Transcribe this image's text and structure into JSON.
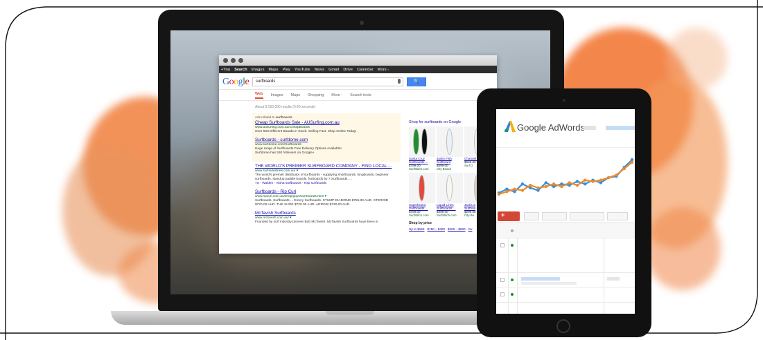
{
  "browser": {
    "gbar": [
      "+You",
      "Search",
      "Images",
      "Maps",
      "Play",
      "YouTube",
      "News",
      "Gmail",
      "Drive",
      "Calendar",
      "More -"
    ],
    "gbar_active": "Search",
    "logo_letters": [
      {
        "ch": "G",
        "color": "#3369e8"
      },
      {
        "ch": "o",
        "color": "#d50f25"
      },
      {
        "ch": "o",
        "color": "#eeb211"
      },
      {
        "ch": "g",
        "color": "#3369e8"
      },
      {
        "ch": "l",
        "color": "#009925"
      },
      {
        "ch": "e",
        "color": "#d50f25"
      }
    ],
    "query": "surfboards",
    "search_button_glyph": "🔍",
    "tabs": [
      "Web",
      "Images",
      "Maps",
      "Shopping",
      "More -",
      "Search tools"
    ],
    "stats": "About 9,150,000 results (0.40 seconds)",
    "ads_label_prefix": "Ads related to ",
    "ads_label_term": "surfboards",
    "ads": [
      {
        "title": "Cheap Surfboards Sale - AUSurfing.com.au",
        "url": "www.ausurfing.com.au/CheapBoards",
        "desc": "Over 500 Different Boards In Stock. Selling Fast. Shop Online Today!"
      },
      {
        "title": "Surfboards - surfdome.com",
        "url": "www.surfdome.com/Surfboards",
        "desc": "Huge range of Surfboards Free Delivery Options Available!",
        "extra": "Surfdome has 530 followers on Google+"
      }
    ],
    "organic": [
      {
        "title": "THE WORLD'S PREMIER SURFBOARD COMPANY - FIND LOCAL ...",
        "url": "www.surfindustries.com.au/ ▾",
        "desc": "The world's premier distributor of surfboards - supplying shortboards, longboards, beginner surfboards, standup paddle boards, funboards by 7 Surfboards, ...",
        "sitelinks": "7S - Walden - Aloha surfboards - Nsp surfboards"
      },
      {
        "title": "Surfboards - Rip Curl",
        "url": "www.ripcurl.com.au/shop/guys/surfboards.html ▾",
        "desc": "Surfboards. Surfboards ... Emery Surfboards. STUMP DIAMOND $755.00 AUD. STEROID $720.00 AUD. THE SHOE $720.00 AUD. ARROW $720.00 AUD."
      },
      {
        "title": "McTavish Surfboards",
        "url": "www.mctavish.com.au/ ▾",
        "desc": "Founded by surf industry pioneer Bob McTavish, McTavish Surfboards have been in"
      }
    ],
    "shop_title": "Shop for surfboards on Google",
    "products": [
      {
        "name": "Santa Cruz Surfboards ...",
        "price": "$799.00",
        "store": "SurfStitch.com",
        "colors": [
          "#1f8f2c",
          "#111111"
        ]
      },
      {
        "name": "Jacks Fish Surfboard",
        "price": "$499.00",
        "store": "City Beach",
        "colors": [
          "#e9f2f7"
        ]
      },
      {
        "name": "Channel ...",
        "price": "$835.00",
        "store": "Surf D",
        "colors": [
          "#f3f3f3"
        ]
      },
      {
        "name": "Superbrand Surfboards ...",
        "price": "$780.00",
        "store": "SurfStitch.com",
        "colors": [
          "#e24a3c"
        ]
      },
      {
        "name": "Liquid Lines Surfboards ...",
        "price": "$499.00",
        "store": "SurfStitch.com",
        "colors": [
          "#f7f7f2"
        ]
      },
      {
        "name": "Jacks S Surfboa",
        "price": "$299.00",
        "store": "City Be",
        "colors": [
          "#d9d2c2"
        ]
      }
    ],
    "shop_by_price": "Shop by price",
    "price_ranges": [
      "Up to $150",
      "$150 – $400",
      "$400 – $600",
      "Ov"
    ]
  },
  "tablet": {
    "app_title": "Google AdWords",
    "new_button_label": "+",
    "chart_data": {
      "type": "line",
      "series": [
        {
          "values": [
            46,
            52,
            48,
            60,
            54,
            50,
            62,
            56,
            60,
            58,
            64,
            60,
            66,
            62,
            70,
            72,
            86,
            98
          ],
          "color": "#3b8fd9"
        },
        {
          "values": [
            44,
            48,
            52,
            50,
            58,
            54,
            56,
            60,
            56,
            62,
            58,
            66,
            64,
            66,
            70,
            74,
            84,
            94
          ],
          "color": "#ef8a2a"
        }
      ],
      "ylim": [
        30,
        110
      ]
    }
  }
}
